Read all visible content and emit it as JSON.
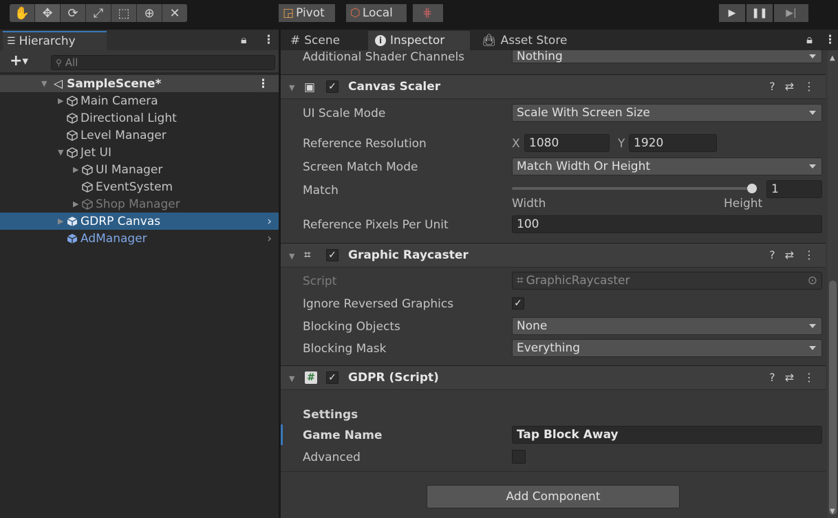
{
  "toolbar": {
    "pivot_label": "Pivot",
    "local_label": "Local",
    "tools": [
      "hand-tool-icon",
      "move-tool-icon",
      "rotate-tool-icon",
      "scale-tool-icon",
      "rect-tool-icon",
      "transform-tool-icon",
      "custom-tool-icon"
    ]
  },
  "hierarchy": {
    "tab_label": "Hierarchy",
    "search_placeholder": "All",
    "scene_name": "SampleScene*",
    "items": [
      {
        "label": "Main Camera"
      },
      {
        "label": "Directional Light"
      },
      {
        "label": "Level Manager"
      },
      {
        "label": "Jet UI"
      },
      {
        "label": "UI Manager"
      },
      {
        "label": "EventSystem"
      },
      {
        "label": "Shop Manager"
      },
      {
        "label": "GDRP Canvas"
      },
      {
        "label": "AdManager"
      }
    ]
  },
  "inspector": {
    "tabs": [
      {
        "label": "Scene"
      },
      {
        "label": "Inspector"
      },
      {
        "label": "Asset Store"
      }
    ],
    "top_row": {
      "label": "Additional Shader Channels",
      "value": "Nothing"
    },
    "canvas_scaler": {
      "title": "Canvas Scaler",
      "ui_scale_mode_label": "UI Scale Mode",
      "ui_scale_mode_value": "Scale With Screen Size",
      "ref_res_label": "Reference Resolution",
      "x_label": "X",
      "x_value": "1080",
      "y_label": "Y",
      "y_value": "1920",
      "screen_match_label": "Screen Match Mode",
      "screen_match_value": "Match Width Or Height",
      "match_label": "Match",
      "match_value": "1",
      "match_fraction": 1.0,
      "width_label": "Width",
      "height_label": "Height",
      "ppu_label": "Reference Pixels Per Unit",
      "ppu_value": "100"
    },
    "graphic_raycaster": {
      "title": "Graphic Raycaster",
      "script_label": "Script",
      "script_value": "GraphicRaycaster",
      "ignore_label": "Ignore Reversed Graphics",
      "blocking_objects_label": "Blocking Objects",
      "blocking_objects_value": "None",
      "blocking_mask_label": "Blocking Mask",
      "blocking_mask_value": "Everything"
    },
    "gdpr": {
      "title": "GDPR (Script)",
      "settings_label": "Settings",
      "game_name_label": "Game Name",
      "game_name_value": "Tap Block Away",
      "advanced_label": "Advanced"
    },
    "add_component_label": "Add Component"
  },
  "colors": {
    "selection": "#2c5d87",
    "accent": "#3a79bb",
    "prefab": "#7ea6e6"
  }
}
